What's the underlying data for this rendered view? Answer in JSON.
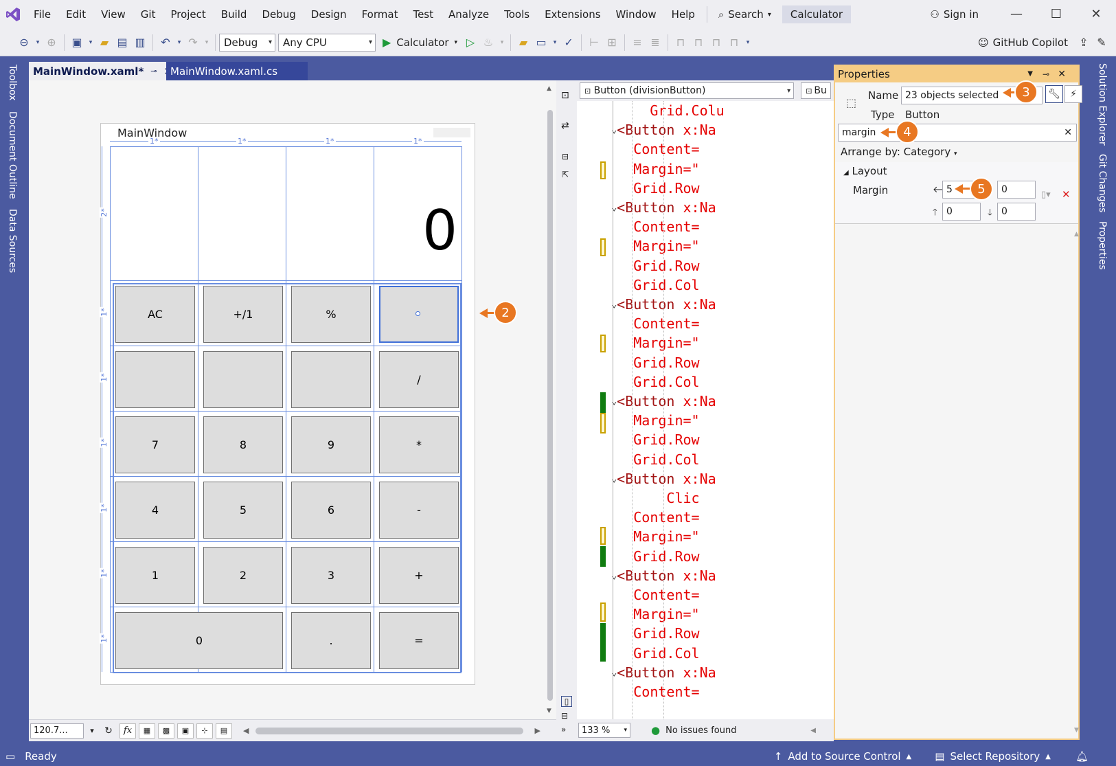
{
  "menubar": {
    "items": [
      "File",
      "Edit",
      "View",
      "Git",
      "Project",
      "Build",
      "Debug",
      "Design",
      "Format",
      "Test",
      "Analyze",
      "Tools",
      "Extensions",
      "Window",
      "Help"
    ],
    "search_label": "Search",
    "solution_name": "Calculator",
    "sign_in": "Sign in"
  },
  "toolbar": {
    "config": "Debug",
    "platform": "Any CPU",
    "run_target": "Calculator",
    "copilot": "GitHub Copilot"
  },
  "left_rail": {
    "tabs": [
      "Toolbox",
      "Document Outline",
      "Data Sources"
    ]
  },
  "right_rail": {
    "tabs": [
      "Solution Explorer",
      "Git Changes",
      "Properties"
    ]
  },
  "doc_tabs": [
    {
      "label": "MainWindow.xaml*",
      "active": true
    },
    {
      "label": "MainWindow.xaml.cs",
      "active": false
    }
  ],
  "designer": {
    "window_title": "MainWindow",
    "display_value": "0",
    "col_markers": [
      "1*",
      "1*",
      "1*",
      "1*"
    ],
    "row_markers": [
      "2*",
      "1*",
      "1*",
      "1*",
      "1*",
      "1*",
      "1*"
    ],
    "buttons": {
      "ac": "AC",
      "negate": "+/1",
      "percent": "%",
      "blank1": "",
      "blank2": "",
      "blank3": "",
      "blank4": "",
      "divide": "/",
      "seven": "7",
      "eight": "8",
      "nine": "9",
      "multiply": "*",
      "four": "4",
      "five": "5",
      "six": "6",
      "minus": "-",
      "one": "1",
      "two": "2",
      "three": "3",
      "plus": "+",
      "zero": "0",
      "dot": ".",
      "equals": "="
    },
    "zoom": "120.7...",
    "fx": "fx"
  },
  "code": {
    "nav_left": "Button (divisionButton)",
    "nav_right": "Bu",
    "zoom": "133 %",
    "issues": "No issues found",
    "lines": [
      {
        "pre": "        ",
        "tag": "",
        "attr": "Grid.Colu",
        "rest": ""
      },
      {
        "pre": "    ",
        "tag": "<Button",
        "attr": " x:Na",
        "rest": ""
      },
      {
        "pre": "      ",
        "tag": "",
        "attr": "Content=",
        "rest": ""
      },
      {
        "pre": "      ",
        "tag": "",
        "attr": "Margin=\"",
        "rest": ""
      },
      {
        "pre": "      ",
        "tag": "",
        "attr": "Grid.Row",
        "rest": ""
      },
      {
        "pre": "    ",
        "tag": "<Button",
        "attr": " x:Na",
        "rest": ""
      },
      {
        "pre": "      ",
        "tag": "",
        "attr": "Content=",
        "rest": ""
      },
      {
        "pre": "      ",
        "tag": "",
        "attr": "Margin=\"",
        "rest": ""
      },
      {
        "pre": "      ",
        "tag": "",
        "attr": "Grid.Row",
        "rest": ""
      },
      {
        "pre": "      ",
        "tag": "",
        "attr": "Grid.Col",
        "rest": ""
      },
      {
        "pre": "    ",
        "tag": "<Button",
        "attr": " x:Na",
        "rest": ""
      },
      {
        "pre": "      ",
        "tag": "",
        "attr": "Content=",
        "rest": ""
      },
      {
        "pre": "      ",
        "tag": "",
        "attr": "Margin=\"",
        "rest": ""
      },
      {
        "pre": "      ",
        "tag": "",
        "attr": "Grid.Row",
        "rest": ""
      },
      {
        "pre": "      ",
        "tag": "",
        "attr": "Grid.Col",
        "rest": ""
      },
      {
        "pre": "    ",
        "tag": "<Button",
        "attr": " x:Na",
        "rest": ""
      },
      {
        "pre": "      ",
        "tag": "",
        "attr": "Margin=\"",
        "rest": ""
      },
      {
        "pre": "      ",
        "tag": "",
        "attr": "Grid.Row",
        "rest": ""
      },
      {
        "pre": "      ",
        "tag": "",
        "attr": "Grid.Col",
        "rest": ""
      },
      {
        "pre": "    ",
        "tag": "<Button",
        "attr": " x:Na",
        "rest": ""
      },
      {
        "pre": "          ",
        "tag": "",
        "attr": "Clic",
        "rest": ""
      },
      {
        "pre": "      ",
        "tag": "",
        "attr": "Content=",
        "rest": ""
      },
      {
        "pre": "      ",
        "tag": "",
        "attr": "Margin=\"",
        "rest": ""
      },
      {
        "pre": "      ",
        "tag": "",
        "attr": "Grid.Row",
        "rest": ""
      },
      {
        "pre": "    ",
        "tag": "<Button",
        "attr": " x:Na",
        "rest": ""
      },
      {
        "pre": "      ",
        "tag": "",
        "attr": "Content=",
        "rest": ""
      },
      {
        "pre": "      ",
        "tag": "",
        "attr": "Margin=\"",
        "rest": ""
      },
      {
        "pre": "      ",
        "tag": "",
        "attr": "Grid.Row",
        "rest": ""
      },
      {
        "pre": "      ",
        "tag": "",
        "attr": "Grid.Col",
        "rest": ""
      },
      {
        "pre": "    ",
        "tag": "<Button",
        "attr": " x:Na",
        "rest": ""
      },
      {
        "pre": "      ",
        "tag": "",
        "attr": "Content=",
        "rest": ""
      }
    ]
  },
  "properties": {
    "title": "Properties",
    "name_label": "Name",
    "name_value": "23 objects selected",
    "type_label": "Type",
    "type_value": "Button",
    "search_value": "margin",
    "arrange_by": "Arrange by: Category",
    "category": "Layout",
    "margin_label": "Margin",
    "margin_left": "5",
    "margin_right": "0",
    "margin_top": "0",
    "margin_bottom": "0"
  },
  "callouts": {
    "c2": "2",
    "c3": "3",
    "c4": "4",
    "c5": "5"
  },
  "status": {
    "ready": "Ready",
    "source_control": "Add to Source Control",
    "repository": "Select Repository"
  },
  "colors": {
    "accent": "#e87722",
    "chrome": "#4b5aa0",
    "props_title": "#f5cc84"
  }
}
